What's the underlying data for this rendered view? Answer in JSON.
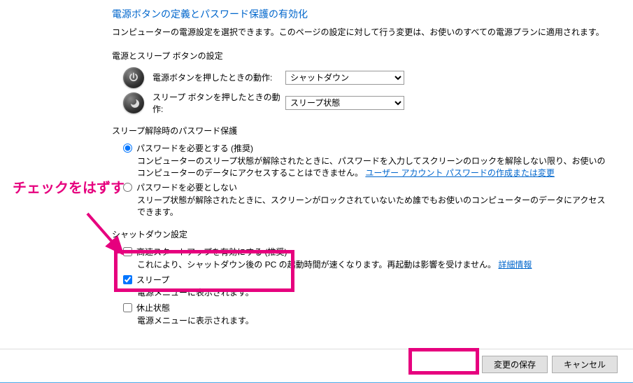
{
  "page_title": "電源ボタンの定義とパスワード保護の有効化",
  "page_desc": "コンピューターの電源設定を選択できます。このページの設定に対して行う変更は、お使いのすべての電源プランに適用されます。",
  "sections": {
    "buttons_header": "電源とスリープ ボタンの設定",
    "power_button_label": "電源ボタンを押したときの動作:",
    "power_button_value": "シャットダウン",
    "sleep_button_label": "スリープ ボタンを押したときの動作:",
    "sleep_button_value": "スリープ状態",
    "password_header": "スリープ解除時のパスワード保護",
    "radio": {
      "require": {
        "label": "パスワードを必要とする (推奨)",
        "desc_prefix": "コンピューターのスリープ状態が解除されたときに、パスワードを入力してスクリーンのロックを解除しない限り、お使いのコンピューターのデータにアクセスすることはできません。",
        "link": "ユーザー アカウント パスワードの作成または変更"
      },
      "norequire": {
        "label": "パスワードを必要としない",
        "desc": "スリープ状態が解除されたときに、スクリーンがロックされていないため誰でもお使いのコンピューターのデータにアクセスできます。"
      }
    },
    "shutdown_header": "シャットダウン設定",
    "checks": {
      "faststartup": {
        "label": "高速スタートアップを有効にする (推奨)",
        "desc_prefix": "これにより、シャットダウン後の PC の起動時間が速くなります。再起動は影響を受けません。",
        "link": "詳細情報"
      },
      "sleep": {
        "label": "スリープ",
        "desc": "電源メニューに表示されます。"
      },
      "hibernate": {
        "label": "休止状態",
        "desc": "電源メニューに表示されます。"
      }
    }
  },
  "buttons": {
    "save": "変更の保存",
    "cancel": "キャンセル"
  },
  "annotation": {
    "uncheck_text": "チェックをはずす"
  }
}
